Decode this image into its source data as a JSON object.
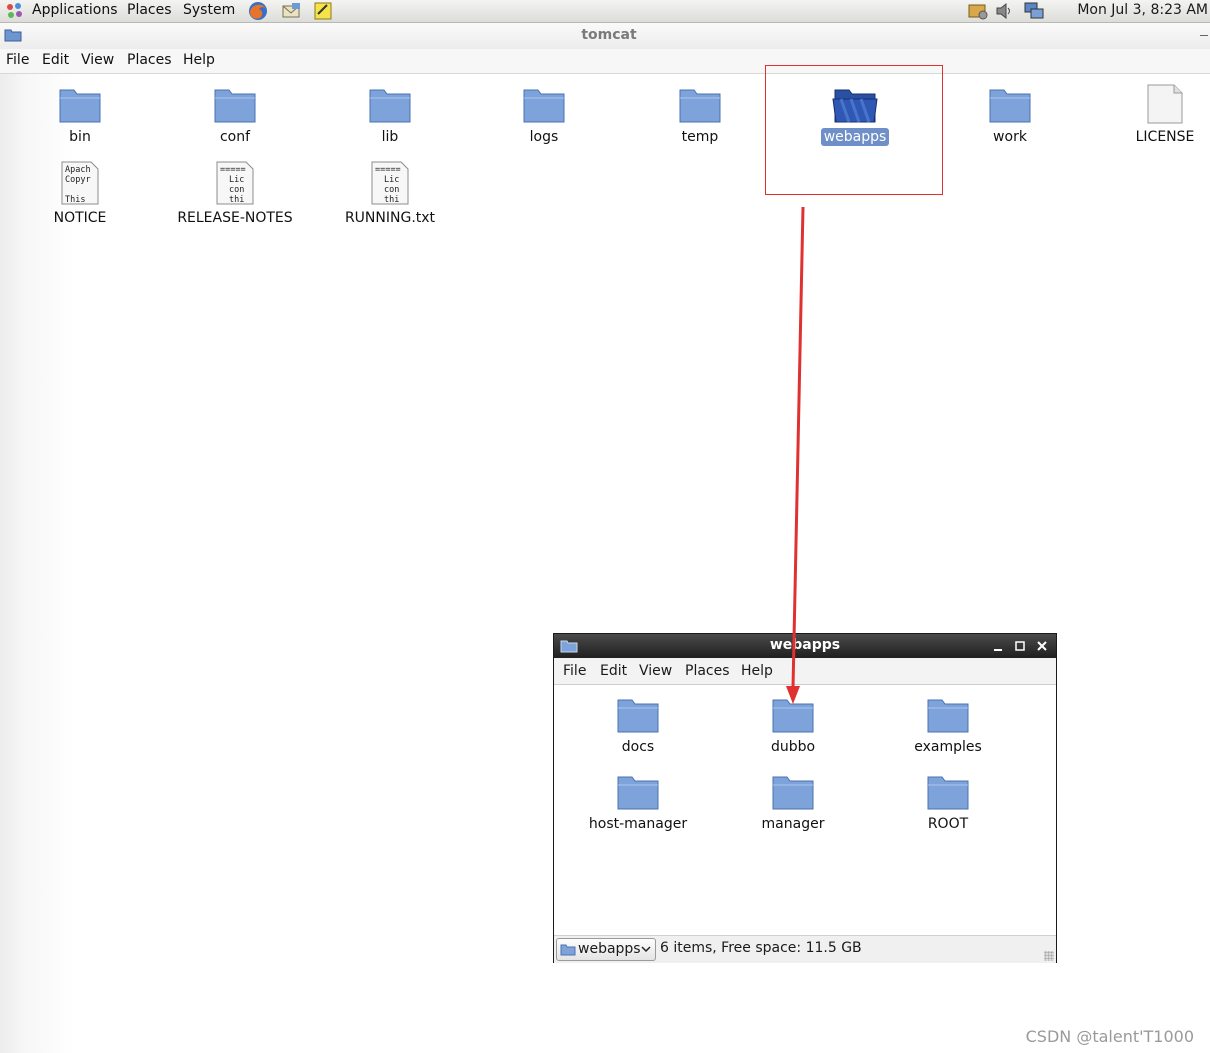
{
  "top_panel": {
    "menus": [
      "Applications",
      "Places",
      "System"
    ],
    "launchers": [
      "firefox-icon",
      "email-icon",
      "notes-icon"
    ],
    "tray": [
      "update-notifier-icon",
      "volume-icon",
      "network-icon"
    ],
    "clock": "Mon Jul  3,  8:23 AM"
  },
  "main_window": {
    "title": "tomcat",
    "menu": [
      "File",
      "Edit",
      "View",
      "Places",
      "Help"
    ],
    "items": [
      {
        "label": "bin",
        "type": "folder"
      },
      {
        "label": "conf",
        "type": "folder"
      },
      {
        "label": "lib",
        "type": "folder"
      },
      {
        "label": "logs",
        "type": "folder"
      },
      {
        "label": "temp",
        "type": "folder"
      },
      {
        "label": "webapps",
        "type": "folder",
        "selected": true
      },
      {
        "label": "work",
        "type": "folder"
      },
      {
        "label": "LICENSE",
        "type": "file"
      },
      {
        "label": "NOTICE",
        "type": "text",
        "preview": [
          "Apach",
          "Copyr",
          "",
          "This"
        ]
      },
      {
        "label": "RELEASE-NOTES",
        "type": "text",
        "preview": [
          "=====",
          "Lic",
          "con",
          "thi"
        ]
      },
      {
        "label": "RUNNING.txt",
        "type": "text",
        "preview": [
          "=====",
          "Lic",
          "con",
          "thi"
        ]
      }
    ]
  },
  "sub_window": {
    "title": "webapps",
    "menu": [
      "File",
      "Edit",
      "View",
      "Places",
      "Help"
    ],
    "items": [
      "docs",
      "dubbo",
      "examples",
      "host-manager",
      "manager",
      "ROOT"
    ],
    "location": "webapps",
    "status": "6 items, Free space: 11.5 GB"
  },
  "colors": {
    "folder": "#7ea3da",
    "selected_folder": "#2b4fa3",
    "selection": "#6e8fc7",
    "annotation": "#e03030"
  },
  "watermark": "CSDN @talent'T1000"
}
